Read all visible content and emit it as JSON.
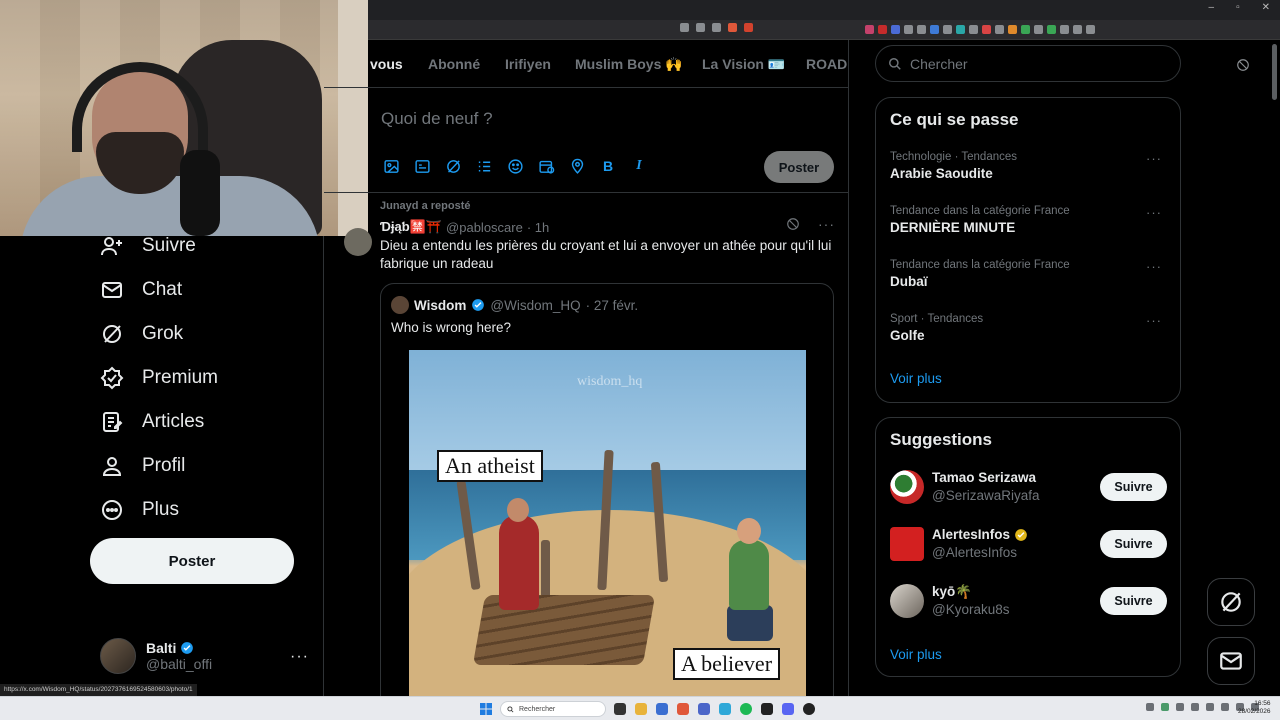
{
  "browser": {
    "win_controls": [
      "–",
      "▫",
      "✕"
    ]
  },
  "nav": {
    "items": [
      {
        "label": "Suivre"
      },
      {
        "label": "Chat"
      },
      {
        "label": "Grok"
      },
      {
        "label": "Premium"
      },
      {
        "label": "Articles"
      },
      {
        "label": "Profil"
      },
      {
        "label": "Plus"
      }
    ],
    "post_button": "Poster",
    "account": {
      "name": "Balti",
      "handle": "@balti_offi",
      "more": "···"
    }
  },
  "tabs": [
    "vous",
    "Abonné",
    "Irifiyen",
    "Muslim Boys 🙌",
    "La Vision 🪪",
    "ROAD"
  ],
  "composer": {
    "placeholder": "Quoi de neuf ?",
    "post_label": "Poster",
    "tool_icons": [
      "image-icon",
      "gif-icon",
      "grok-icon",
      "poll-icon",
      "emoji-icon",
      "schedule-icon",
      "location-icon",
      "bold-icon",
      "italic-icon"
    ],
    "bold_glyph": "B",
    "italic_glyph": "I"
  },
  "tweet": {
    "repost_line": "Junayd a reposté",
    "author": "Ɗɉąƅ🈲⛩️",
    "handle": "@pabloscare",
    "time": "· 1h",
    "more": "···",
    "text": "Dieu a entendu les prières du croyant et lui a envoyer un athée pour qu'il lui fabrique un radeau",
    "quote": {
      "author": "Wisdom",
      "handle": "@Wisdom_HQ",
      "time": "· 27 févr.",
      "text": "Who is wrong here?",
      "image": {
        "watermark": "wisdom_hq",
        "label_left": "An atheist",
        "label_right": "A believer"
      }
    }
  },
  "search": {
    "placeholder": "Chercher"
  },
  "trends": {
    "title": "Ce qui se passe",
    "items": [
      {
        "meta": "Technologie · Tendances",
        "topic": "Arabie Saoudite"
      },
      {
        "meta": "Tendance dans la catégorie France",
        "topic": "DERNIÈRE MINUTE"
      },
      {
        "meta": "Tendance dans la catégorie France",
        "topic": "Dubaï"
      },
      {
        "meta": "Sport · Tendances",
        "topic": "Golfe"
      }
    ],
    "more_glyph": "···",
    "see_more": "Voir plus"
  },
  "suggestions": {
    "title": "Suggestions",
    "items": [
      {
        "name": "Tamao Serizawa",
        "handle": "@SerizawaRiyafa",
        "follow": "Suivre",
        "verified": false
      },
      {
        "name": "AlertesInfos",
        "handle": "@AlertesInfos",
        "follow": "Suivre",
        "verified": true
      },
      {
        "name": "kyō🌴",
        "handle": "@Kyoraku8s",
        "follow": "Suivre",
        "verified": false
      }
    ],
    "see_more": "Voir plus"
  },
  "status_bar_url": "https://x.com/Wisdom_HQ/status/2027376169524580603/photo/1",
  "taskbar": {
    "search_placeholder": "Rechercher",
    "time": "16:56",
    "date": "28/02/2026"
  },
  "colors": {
    "accent": "#1d9bf0",
    "background": "#000000",
    "muted_text": "#71767b",
    "border": "#2f3336"
  }
}
